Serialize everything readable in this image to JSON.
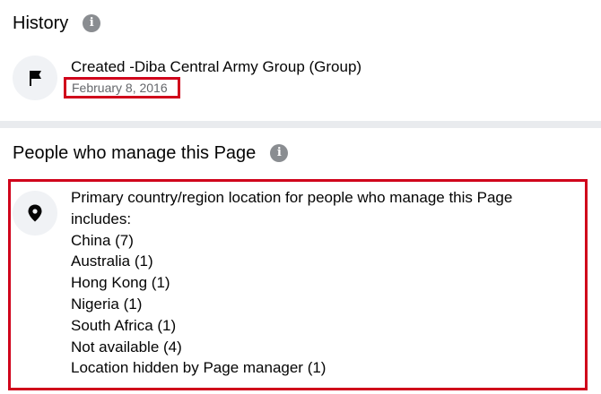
{
  "history": {
    "title": "History",
    "event": "Created -Diba Central Army Group (Group)",
    "date": "February 8, 2016"
  },
  "managers": {
    "title": "People who manage this Page",
    "intro_line1": "Primary country/region location for people who manage this Page",
    "intro_line2": "includes:",
    "locations": [
      "China (7)",
      "Australia (1)",
      "Hong Kong (1)",
      "Nigeria (1)",
      "South Africa (1)",
      "Not available (4)",
      "Location hidden by Page manager (1)"
    ]
  },
  "icons": {
    "info": "info-icon",
    "flag": "flag-icon",
    "location": "map-pin-icon"
  },
  "colors": {
    "highlight": "#d0021b",
    "secondary_text": "#65676b",
    "icon_bg": "#f0f2f5"
  }
}
